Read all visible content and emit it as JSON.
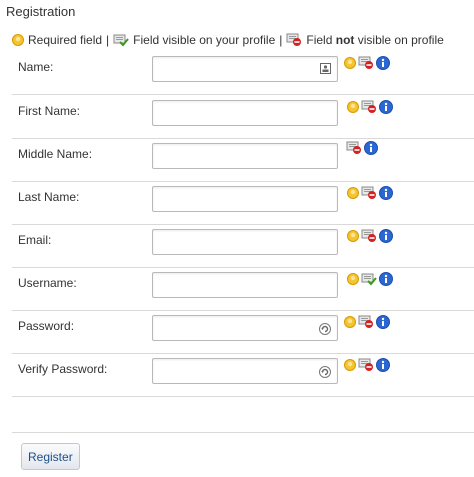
{
  "header": {
    "title": "Registration"
  },
  "legend": {
    "required_text": "Required field",
    "separator": "|",
    "visible_text": "Field visible on your profile",
    "not_visible_prefix": "Field",
    "not_visible_bold": "not",
    "not_visible_suffix": "visible on profile"
  },
  "fields": [
    {
      "label": "Name:",
      "value": "",
      "required": true,
      "visibility": "hidden",
      "field_icon": "id-card-icon"
    },
    {
      "label": "First Name:",
      "value": "",
      "required": true,
      "visibility": "hidden"
    },
    {
      "label": "Middle Name:",
      "value": "",
      "required": false,
      "visibility": "hidden"
    },
    {
      "label": "Last Name:",
      "value": "",
      "required": true,
      "visibility": "hidden"
    },
    {
      "label": "Email:",
      "value": "",
      "required": true,
      "visibility": "hidden"
    },
    {
      "label": "Username:",
      "value": "",
      "required": true,
      "visibility": "visible"
    },
    {
      "label": "Password:",
      "value": "",
      "required": true,
      "visibility": "hidden",
      "field_icon": "refresh-icon"
    },
    {
      "label": "Verify Password:",
      "value": "",
      "required": true,
      "visibility": "hidden",
      "field_icon": "refresh-icon"
    }
  ],
  "actions": {
    "register_label": "Register"
  },
  "colors": {
    "required": "#f0b000",
    "info": "#2a67d4",
    "not_visible": "#d22222",
    "visible": "#4a9a2a",
    "button_text": "#1f4e8c"
  }
}
